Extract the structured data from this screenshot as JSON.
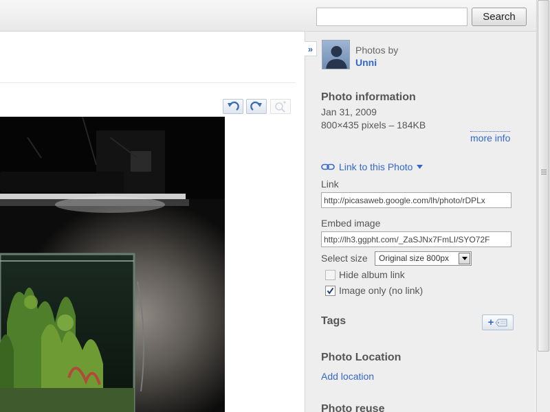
{
  "search": {
    "placeholder": "",
    "value": "",
    "button_label": "Search"
  },
  "main": {
    "tools": [
      {
        "name": "rotate-left",
        "icon": "rotate-left-icon"
      },
      {
        "name": "rotate-right",
        "icon": "rotate-right-icon"
      },
      {
        "name": "zoom",
        "icon": "zoom-in-icon"
      }
    ]
  },
  "sidebar": {
    "collapse_label": "»",
    "owner": {
      "prefix": "Photos by",
      "name": "Unni"
    },
    "photo_info": {
      "heading": "Photo information",
      "date": "Jan 31, 2009",
      "dimensions": "800×435 pixels – 184KB",
      "more_info": "more info"
    },
    "link_to_photo": "Link to this Photo",
    "link": {
      "label": "Link",
      "value": "http://picasaweb.google.com/lh/photo/rDPLx"
    },
    "embed": {
      "label": "Embed image",
      "value": "http://lh3.ggpht.com/_ZaSJNx7FmLI/SYO72F"
    },
    "select_size": {
      "label": "Select size",
      "selected": "Original size 800px"
    },
    "hide_album_link": {
      "label": "Hide album link",
      "checked": false,
      "disabled": true
    },
    "image_only": {
      "label": "Image only (no link)",
      "checked": true
    },
    "tags": {
      "heading": "Tags"
    },
    "location": {
      "heading": "Photo Location",
      "add": "Add location"
    },
    "reuse": {
      "heading": "Photo reuse"
    }
  },
  "colors": {
    "link": "#3366cc",
    "sidebar_bg": "#eeeeee"
  }
}
